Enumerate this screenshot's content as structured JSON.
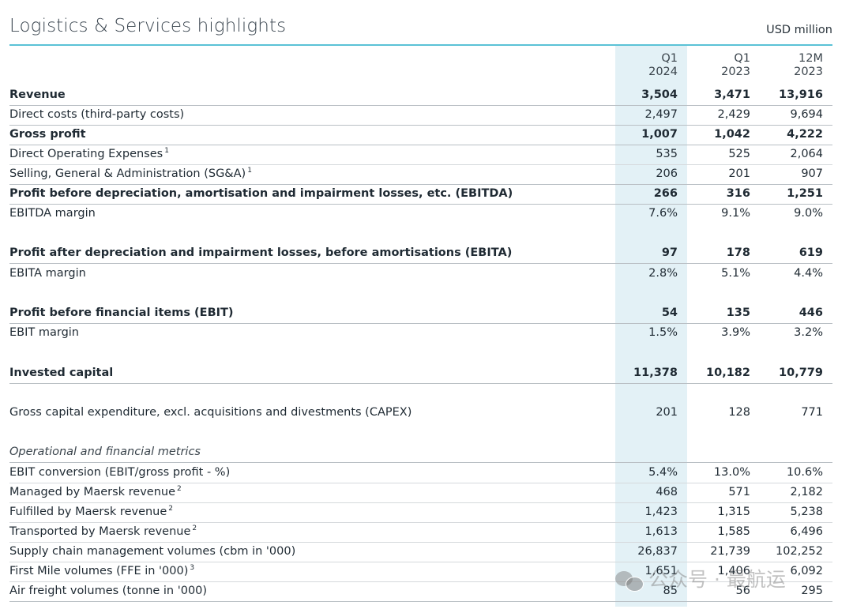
{
  "title": "Logistics & Services highlights",
  "unit": "USD million",
  "columns": [
    {
      "line1": "Q1",
      "line2": "2024"
    },
    {
      "line1": "Q1",
      "line2": "2023"
    },
    {
      "line1": "12M",
      "line2": "2023"
    }
  ],
  "rows": [
    {
      "label": "Revenue",
      "sup": "",
      "v1": "3,504",
      "v2": "3,471",
      "v3": "13,916"
    },
    {
      "label": "Direct costs (third-party costs)",
      "sup": "",
      "v1": "2,497",
      "v2": "2,429",
      "v3": "9,694"
    },
    {
      "label": "Gross profit",
      "sup": "",
      "v1": "1,007",
      "v2": "1,042",
      "v3": "4,222"
    },
    {
      "label": "Direct Operating Expenses",
      "sup": "1",
      "v1": "535",
      "v2": "525",
      "v3": "2,064"
    },
    {
      "label": "Selling, General & Administration (SG&A)",
      "sup": "1",
      "v1": "206",
      "v2": "201",
      "v3": "907"
    },
    {
      "label": "Profit before depreciation, amortisation and impairment losses, etc. (EBITDA)",
      "sup": "",
      "v1": "266",
      "v2": "316",
      "v3": "1,251"
    },
    {
      "label": "EBITDA margin",
      "sup": "",
      "v1": "7.6%",
      "v2": "9.1%",
      "v3": "9.0%"
    },
    {
      "label": "Profit after depreciation and impairment losses, before amortisations (EBITA)",
      "sup": "",
      "v1": "97",
      "v2": "178",
      "v3": "619"
    },
    {
      "label": "EBITA margin",
      "sup": "",
      "v1": "2.8%",
      "v2": "5.1%",
      "v3": "4.4%"
    },
    {
      "label": "Profit before financial items (EBIT)",
      "sup": "",
      "v1": "54",
      "v2": "135",
      "v3": "446"
    },
    {
      "label": "EBIT margin",
      "sup": "",
      "v1": "1.5%",
      "v2": "3.9%",
      "v3": "3.2%"
    },
    {
      "label": "Invested capital",
      "sup": "",
      "v1": "11,378",
      "v2": "10,182",
      "v3": "10,779"
    },
    {
      "label": "Gross capital expenditure, excl. acquisitions and divestments (CAPEX)",
      "sup": "",
      "v1": "201",
      "v2": "128",
      "v3": "771"
    },
    {
      "label": "Operational and financial metrics",
      "sup": "",
      "v1": "",
      "v2": "",
      "v3": ""
    },
    {
      "label": "EBIT conversion (EBIT/gross profit - %)",
      "sup": "",
      "v1": "5.4%",
      "v2": "13.0%",
      "v3": "10.6%"
    },
    {
      "label": "Managed by Maersk revenue",
      "sup": "2",
      "v1": "468",
      "v2": "571",
      "v3": "2,182"
    },
    {
      "label": "Fulfilled by Maersk revenue",
      "sup": "2",
      "v1": "1,423",
      "v2": "1,315",
      "v3": "5,238"
    },
    {
      "label": "Transported by Maersk revenue",
      "sup": "2",
      "v1": "1,613",
      "v2": "1,585",
      "v3": "6,496"
    },
    {
      "label": "Supply chain management volumes (cbm in '000)",
      "sup": "",
      "v1": "26,837",
      "v2": "21,739",
      "v3": "102,252"
    },
    {
      "label": "First Mile volumes (FFE in '000)",
      "sup": "3",
      "v1": "1,651",
      "v2": "1,406",
      "v3": "6,092"
    },
    {
      "label": "Air freight volumes (tonne in '000)",
      "sup": "",
      "v1": "85",
      "v2": "56",
      "v3": "295"
    }
  ],
  "watermark": "公众号 · 最航运"
}
